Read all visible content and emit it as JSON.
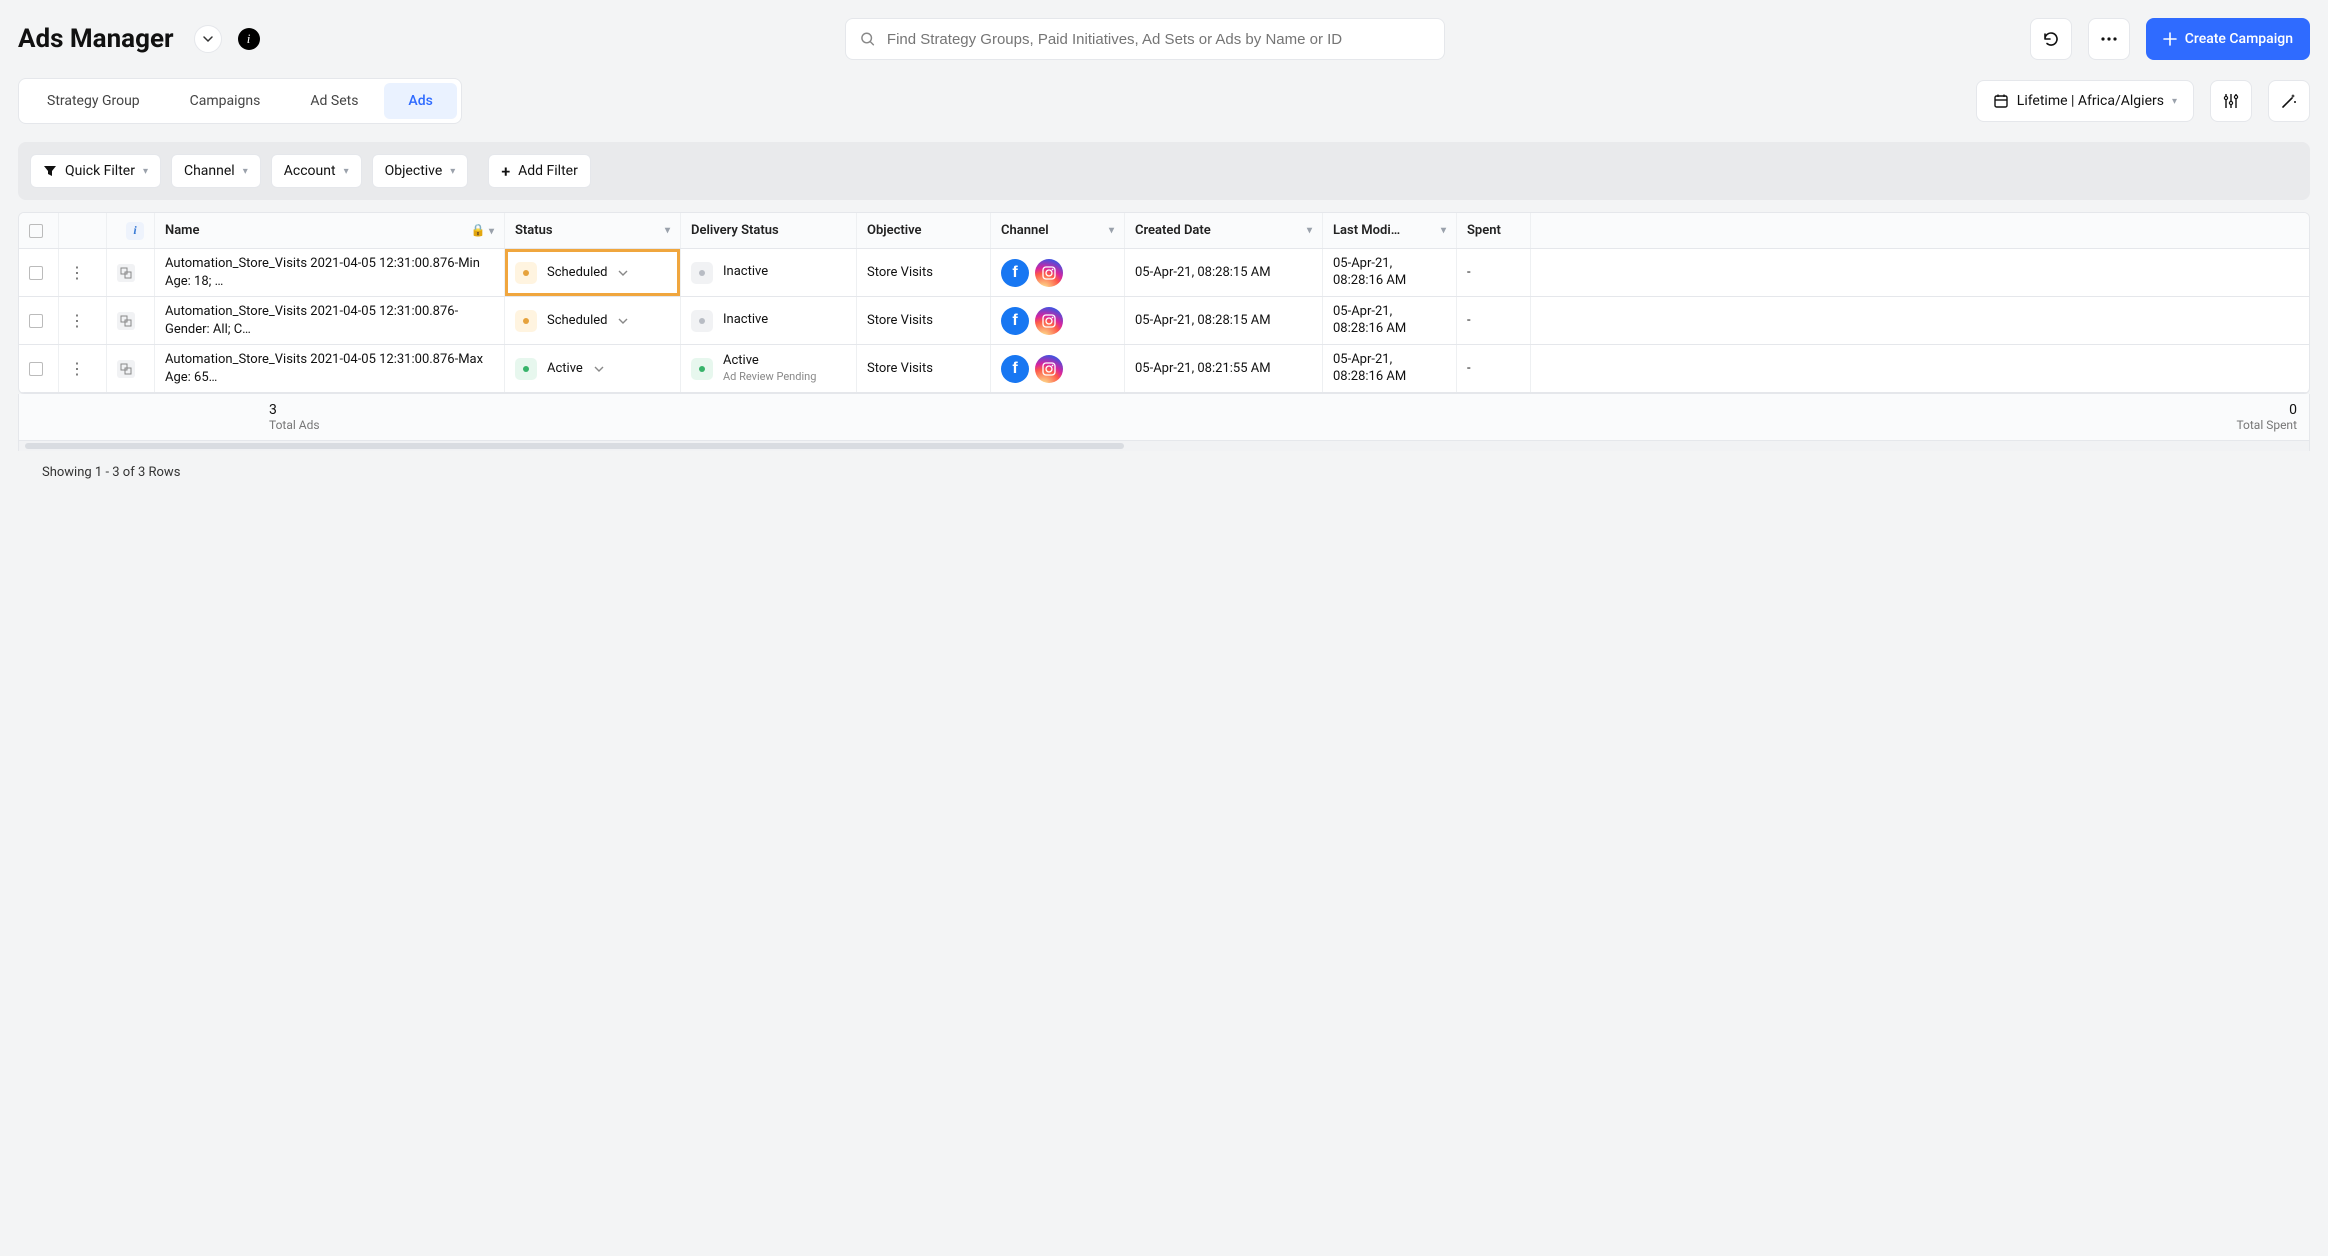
{
  "header": {
    "title": "Ads Manager",
    "search_placeholder": "Find Strategy Groups, Paid Initiatives, Ad Sets or Ads by Name or ID",
    "create_label": "Create Campaign"
  },
  "tabs": {
    "items": [
      "Strategy Group",
      "Campaigns",
      "Ad Sets",
      "Ads"
    ],
    "active_index": 3
  },
  "range_label": "Lifetime | Africa/Algiers",
  "filters": {
    "quick": "Quick Filter",
    "items": [
      "Channel",
      "Account",
      "Objective"
    ],
    "add": "Add Filter"
  },
  "columns": [
    "Name",
    "Status",
    "Delivery Status",
    "Objective",
    "Channel",
    "Created Date",
    "Last Modi…",
    "Spent"
  ],
  "rows": [
    {
      "name": "Automation_Store_Visits 2021-04-05 12:31:00.876-Min Age: 18; …",
      "status": "Scheduled",
      "status_color": "orange",
      "highlighted": true,
      "delivery": "Inactive",
      "delivery_color": "grey",
      "delivery_sub": "",
      "objective": "Store Visits",
      "created": "05-Apr-21, 08:28:15 AM",
      "modified": "05-Apr-21, 08:28:16 AM",
      "spent": "-"
    },
    {
      "name": "Automation_Store_Visits 2021-04-05 12:31:00.876-Gender: All; C…",
      "status": "Scheduled",
      "status_color": "orange",
      "highlighted": false,
      "delivery": "Inactive",
      "delivery_color": "grey",
      "delivery_sub": "",
      "objective": "Store Visits",
      "created": "05-Apr-21, 08:28:15 AM",
      "modified": "05-Apr-21, 08:28:16 AM",
      "spent": "-"
    },
    {
      "name": "Automation_Store_Visits 2021-04-05 12:31:00.876-Max Age: 65…",
      "status": "Active",
      "status_color": "green",
      "highlighted": false,
      "delivery": "Active",
      "delivery_color": "green",
      "delivery_sub": "Ad Review Pending",
      "objective": "Store Visits",
      "created": "05-Apr-21, 08:21:55 AM",
      "modified": "05-Apr-21, 08:28:16 AM",
      "spent": "-"
    }
  ],
  "totals": {
    "ads_count": "3",
    "ads_label": "Total Ads",
    "spent_count": "0",
    "spent_label": "Total Spent"
  },
  "pager": "Showing 1 - 3 of 3 Rows"
}
